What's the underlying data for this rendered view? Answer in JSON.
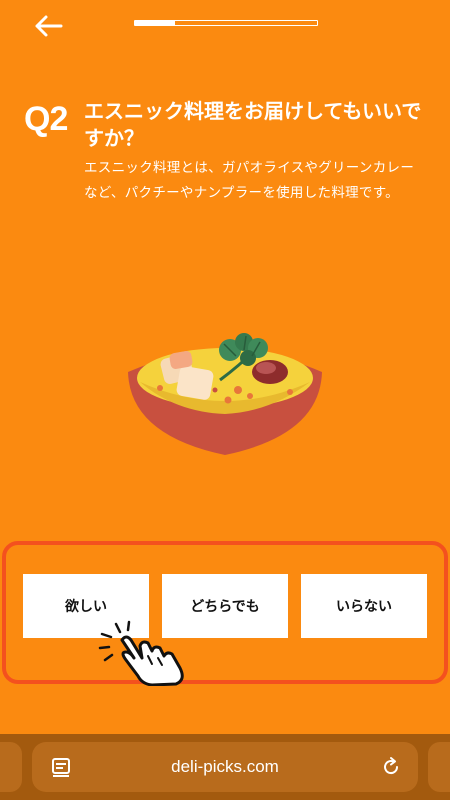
{
  "nav": {
    "back_icon": "arrow-left-icon"
  },
  "progress": {
    "fraction": 0.22
  },
  "question": {
    "number": "Q2",
    "title": "エスニック料理をお届けしてもいいですか？",
    "description": "エスニック料理とは、ガパオライスやグリーンカレーなど、パクチーやナンプラーを使用した料理です。"
  },
  "illustration": {
    "icon": "ethnic-curry-bowl-illustration"
  },
  "options": [
    "欲しい",
    "どちらでも",
    "いらない"
  ],
  "pointer": {
    "icon": "tap-hand-icon"
  },
  "browser": {
    "url": "deli-picks.com",
    "left_icon": "tabs-icon",
    "right_icon": "reload-icon"
  },
  "colors": {
    "background": "#FB8A10",
    "frame": "#F4511E",
    "bowl": "#C8503F",
    "browser_bar": "#A35A0E"
  }
}
